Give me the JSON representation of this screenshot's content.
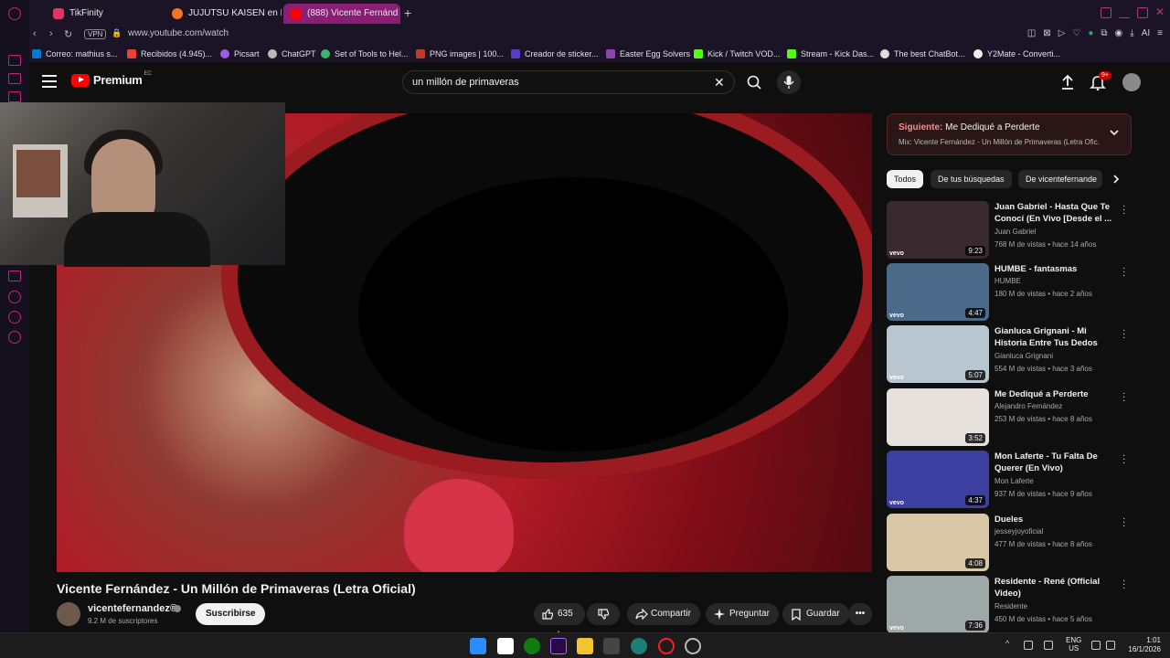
{
  "browser": {
    "tabs": [
      {
        "label": "TikFinity",
        "active": false
      },
      {
        "label": "JUJUTSU KAISEN en Esp",
        "active": false
      },
      {
        "label": "(888) Vicente Fernánd",
        "active": true
      }
    ],
    "vpn_label": "VPN",
    "url": "www.youtube.com/watch",
    "extension_label": "AI",
    "bookmarks": [
      "Correo: mathius s...",
      "Recibidos (4.945)...",
      "Picsart",
      "ChatGPT",
      "Set of Tools to Hel...",
      "PNG images | 100...",
      "Creador de sticker...",
      "Easter Egg Solvers",
      "Kick / Twitch VOD...",
      "Stream - Kick Das...",
      "The best ChatBot...",
      "Y2Mate - Converti..."
    ]
  },
  "youtube": {
    "logo_text": "Premium",
    "logo_region": "EC",
    "search_value": "un millón de primaveras",
    "notification_badge": "9+",
    "video": {
      "title": "Vicente Fernández - Un Millón de Primaveras (Letra Oficial)",
      "channel": "vicentefernandez®",
      "subscribers": "9.2 M de suscriptores",
      "subscribe_label": "Suscribirse",
      "likes": "635 k",
      "share_label": "Compartir",
      "ask_label": "Preguntar",
      "save_label": "Guardar"
    },
    "up_next": {
      "label": "Siguiente:",
      "title": "Me Dediqué a Perderte",
      "mix": "Mix: Vicente Fernández - Un Millón de Primaveras (Letra Ofic..."
    },
    "chips": [
      "Todos",
      "De tus búsquedas",
      "De vicentefernande"
    ],
    "recommendations": [
      {
        "title": "Juan Gabriel - Hasta Que Te Conocí (En Vivo [Desde el ...",
        "channel": "Juan Gabriel",
        "meta": "768 M de vistas • hace 14 años",
        "duration": "9:23",
        "vevo": "vevo",
        "color": "#3a2a30"
      },
      {
        "title": "HUMBE - fantasmas",
        "channel": "HUMBE",
        "meta": "180 M de vistas • hace 2 años",
        "duration": "4:47",
        "vevo": "vevo",
        "color": "#4b6a8a"
      },
      {
        "title": "Gianluca Grignani - Mi Historia Entre Tus Dedos",
        "channel": "Gianluca Grignani",
        "meta": "554 M de vistas • hace 3 años",
        "duration": "5:07",
        "vevo": "vevo",
        "color": "#b8c6cf"
      },
      {
        "title": "Me Dediqué a Perderte",
        "channel": "Alejandro Fernández",
        "meta": "253 M de vistas • hace 8 años",
        "duration": "3:52",
        "vevo": "",
        "color": "#e6e1dc"
      },
      {
        "title": "Mon Laferte - Tu Falta De Querer (En Vivo)",
        "channel": "Mon Laferte",
        "meta": "937 M de vistas • hace 9 años",
        "duration": "4:37",
        "vevo": "vevo",
        "color": "#3b3fa0"
      },
      {
        "title": "Dueles",
        "channel": "jesseyjoyoficial",
        "meta": "477 M de vistas • hace 8 años",
        "duration": "4:08",
        "vevo": "",
        "color": "#d8c8a6"
      },
      {
        "title": "Residente - René (Official Video)",
        "channel": "Residente",
        "meta": "450 M de vistas • hace 5 años",
        "duration": "7:36",
        "vevo": "vevo",
        "color": "#9fa8a8"
      }
    ]
  },
  "taskbar": {
    "lang": "ENG",
    "region": "US",
    "time": "1:01",
    "date": "16/1/2026"
  }
}
